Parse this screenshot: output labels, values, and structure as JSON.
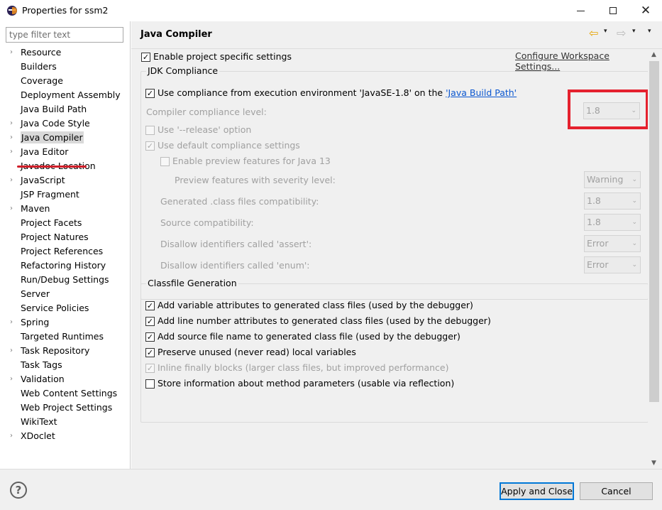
{
  "window": {
    "title": "Properties for ssm2",
    "controls": {
      "minimize": "minimize-icon",
      "maximize": "maximize-icon",
      "close": "close-icon"
    }
  },
  "filter": {
    "placeholder": "type filter text",
    "value": ""
  },
  "tree": {
    "items": [
      {
        "label": "Resource",
        "expandable": true
      },
      {
        "label": "Builders",
        "expandable": false
      },
      {
        "label": "Coverage",
        "expandable": false
      },
      {
        "label": "Deployment Assembly",
        "expandable": false
      },
      {
        "label": "Java Build Path",
        "expandable": false
      },
      {
        "label": "Java Code Style",
        "expandable": true
      },
      {
        "label": "Java Compiler",
        "expandable": true,
        "selected": true
      },
      {
        "label": "Java Editor",
        "expandable": true
      },
      {
        "label": "Javadoc Location",
        "expandable": false
      },
      {
        "label": "JavaScript",
        "expandable": true
      },
      {
        "label": "JSP Fragment",
        "expandable": false
      },
      {
        "label": "Maven",
        "expandable": true
      },
      {
        "label": "Project Facets",
        "expandable": false
      },
      {
        "label": "Project Natures",
        "expandable": false
      },
      {
        "label": "Project References",
        "expandable": false
      },
      {
        "label": "Refactoring History",
        "expandable": false
      },
      {
        "label": "Run/Debug Settings",
        "expandable": false
      },
      {
        "label": "Server",
        "expandable": false
      },
      {
        "label": "Service Policies",
        "expandable": false
      },
      {
        "label": "Spring",
        "expandable": true
      },
      {
        "label": "Targeted Runtimes",
        "expandable": false
      },
      {
        "label": "Task Repository",
        "expandable": true
      },
      {
        "label": "Task Tags",
        "expandable": false
      },
      {
        "label": "Validation",
        "expandable": true
      },
      {
        "label": "Web Content Settings",
        "expandable": false
      },
      {
        "label": "Web Project Settings",
        "expandable": false
      },
      {
        "label": "WikiText",
        "expandable": false
      },
      {
        "label": "XDoclet",
        "expandable": true
      }
    ]
  },
  "page": {
    "title": "Java Compiler",
    "enable_specific": {
      "label": "Enable project specific settings",
      "checked": true
    },
    "configure_workspace_link": "Configure Workspace Settings...",
    "jdk": {
      "group_title": "JDK Compliance",
      "use_compliance_prefix": "Use compliance from execution environment 'JavaSE-1.8' on the ",
      "use_compliance_link": "'Java Build Path'",
      "use_compliance_checked": true,
      "compliance_level_label": "Compiler compliance level:",
      "compliance_level_value": "1.8",
      "release_label": "Use '--release' option",
      "release_checked": false,
      "default_compliance_label": "Use default compliance settings",
      "default_compliance_checked": true,
      "preview_label": "Enable preview features for Java 13",
      "preview_checked": false,
      "preview_severity_label": "Preview features with severity level:",
      "preview_severity_value": "Warning",
      "class_compat_label": "Generated .class files compatibility:",
      "class_compat_value": "1.8",
      "source_compat_label": "Source compatibility:",
      "source_compat_value": "1.8",
      "assert_label": "Disallow identifiers called 'assert':",
      "assert_value": "Error",
      "enum_label": "Disallow identifiers called 'enum':",
      "enum_value": "Error"
    },
    "classfile": {
      "group_title": "Classfile Generation",
      "options": [
        {
          "label": "Add variable attributes to generated class files (used by the debugger)",
          "checked": true,
          "enabled": true
        },
        {
          "label": "Add line number attributes to generated class files (used by the debugger)",
          "checked": true,
          "enabled": true
        },
        {
          "label": "Add source file name to generated class file (used by the debugger)",
          "checked": true,
          "enabled": true
        },
        {
          "label": "Preserve unused (never read) local variables",
          "checked": true,
          "enabled": true
        },
        {
          "label": "Inline finally blocks (larger class files, but improved performance)",
          "checked": true,
          "enabled": false
        },
        {
          "label": "Store information about method parameters (usable via reflection)",
          "checked": false,
          "enabled": true
        }
      ]
    }
  },
  "buttons": {
    "help": "?",
    "apply_close": "Apply and Close",
    "cancel": "Cancel"
  },
  "colors": {
    "annotation_red": "#e5212e",
    "link_blue": "#0b57d0",
    "default_button_border": "#0078d7"
  },
  "glyphs": {
    "arrow": "›",
    "check": "✓",
    "chevron": "⌄",
    "back": "⇦",
    "forward": "⇨",
    "dropdown": "▾",
    "scroll_up": "▲",
    "scroll_down": "▼",
    "close": "✕"
  }
}
